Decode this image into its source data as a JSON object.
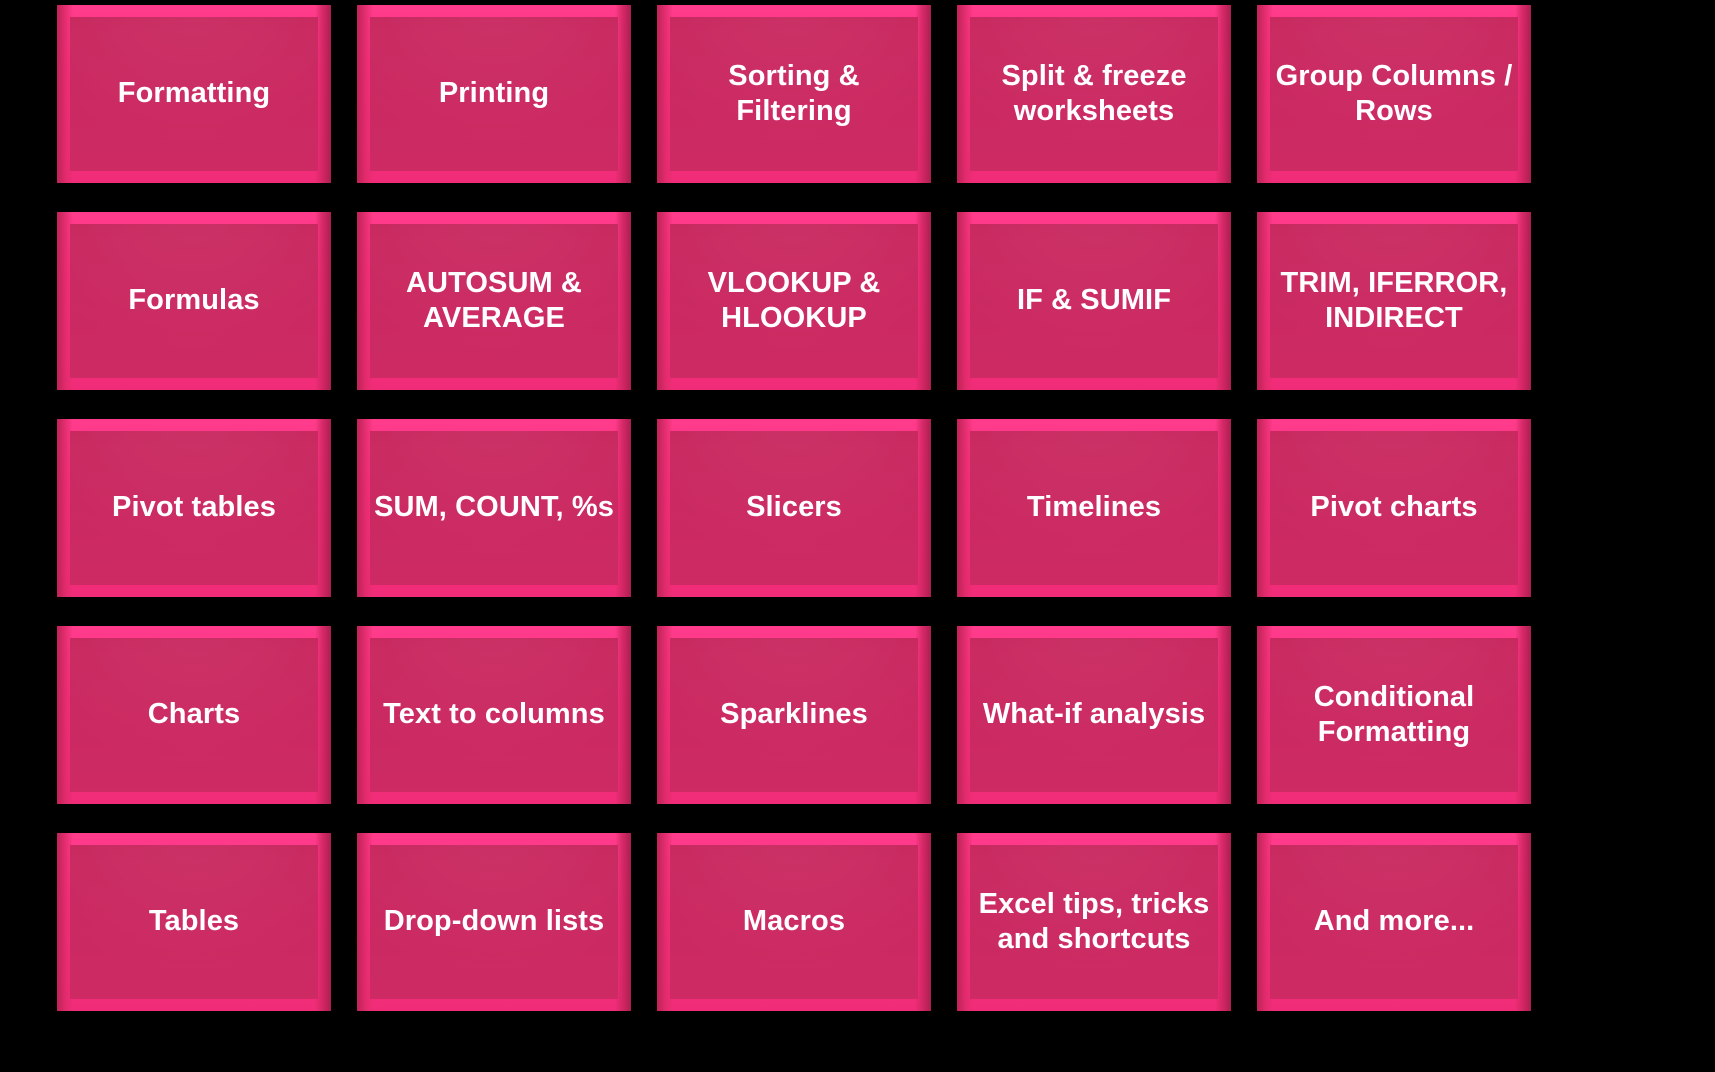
{
  "board": {
    "background_color": "#000000",
    "rows": 5,
    "columns": 5,
    "tile_face_color": "#C9285F",
    "tile_bevel_color": "#FF2E82",
    "tile_text_color": "#FFFFFF"
  },
  "tiles": [
    {
      "label": "Formatting"
    },
    {
      "label": "Printing"
    },
    {
      "label": "Sorting &\nFiltering"
    },
    {
      "label": "Split & freeze\nworksheets"
    },
    {
      "label": "Group Columns /\nRows"
    },
    {
      "label": "Formulas"
    },
    {
      "label": "AUTOSUM &\nAVERAGE"
    },
    {
      "label": "VLOOKUP &\nHLOOKUP"
    },
    {
      "label": "IF & SUMIF"
    },
    {
      "label": "TRIM, IFERROR,\nINDIRECT"
    },
    {
      "label": "Pivot tables"
    },
    {
      "label": "SUM, COUNT, %s"
    },
    {
      "label": "Slicers"
    },
    {
      "label": "Timelines"
    },
    {
      "label": "Pivot charts"
    },
    {
      "label": "Charts"
    },
    {
      "label": "Text to columns"
    },
    {
      "label": "Sparklines"
    },
    {
      "label": "What-if analysis"
    },
    {
      "label": "Conditional\nFormatting"
    },
    {
      "label": "Tables"
    },
    {
      "label": "Drop-down lists"
    },
    {
      "label": "Macros"
    },
    {
      "label": "Excel tips, tricks\nand shortcuts"
    },
    {
      "label": "And more..."
    }
  ]
}
